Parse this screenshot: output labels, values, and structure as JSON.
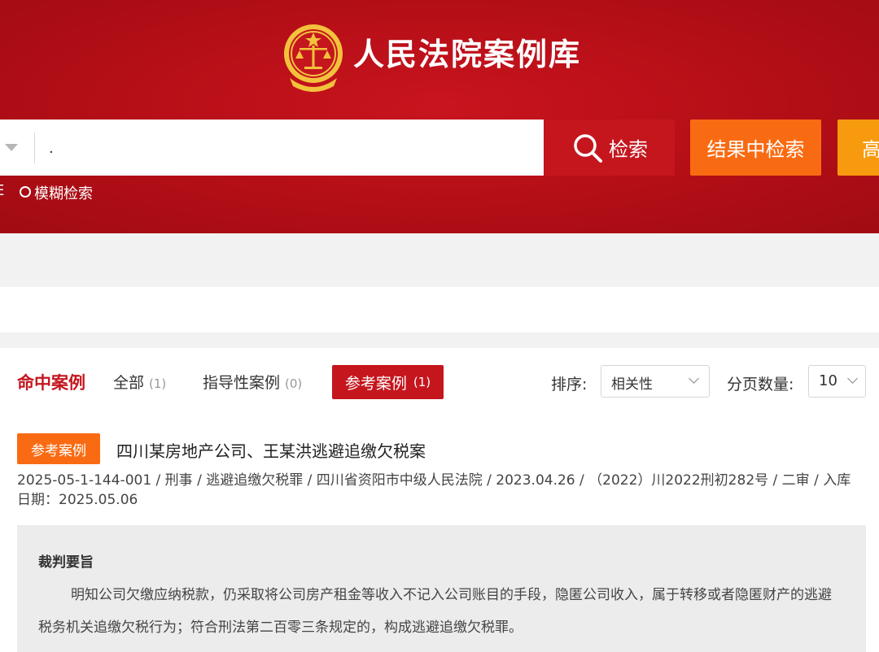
{
  "header": {
    "site_title": "人民法院案例库",
    "colors": {
      "header_red": "#b80f18",
      "emblem_gold": "#f3c23c"
    }
  },
  "search": {
    "input_value": ".",
    "search_button": "检索",
    "search_in_results_button": "结果中检索",
    "advanced_button": "高",
    "exact_option_partial": "E",
    "fuzzy_option": "模糊检索",
    "colors": {
      "search_red": "#c5161e",
      "orange": "#f96b12",
      "amber": "#f89a0e"
    }
  },
  "results": {
    "heading": "命中案例",
    "tabs": [
      {
        "label": "全部",
        "count": "(1)"
      },
      {
        "label": "指导性案例",
        "count": "(0)"
      },
      {
        "label": "参考案例",
        "count": "(1)"
      }
    ],
    "sort_label": "排序:",
    "sort_value": "相关性",
    "page_size_label": "分页数量:",
    "page_size_value": "10",
    "items": [
      {
        "badge": "参考案例",
        "title": "四川某房地产公司、王某洪逃避追缴欠税案",
        "meta": "2025-05-1-144-001 / 刑事 / 逃避追缴欠税罪 / 四川省资阳市中级人民法院 / 2023.04.26 / （2022）川2022刑初282号 / 二审 / 入库日期：2025.05.06",
        "summary_heading": "裁判要旨",
        "summary_text": "明知公司欠缴应纳税款，仍采取将公司房产租金等收入不记入公司账目的手段，隐匿公司收入，属于转移或者隐匿财产的逃避税务机关追缴欠税行为；符合刑法第二百零三条规定的，构成逃避追缴欠税罪。"
      }
    ]
  }
}
